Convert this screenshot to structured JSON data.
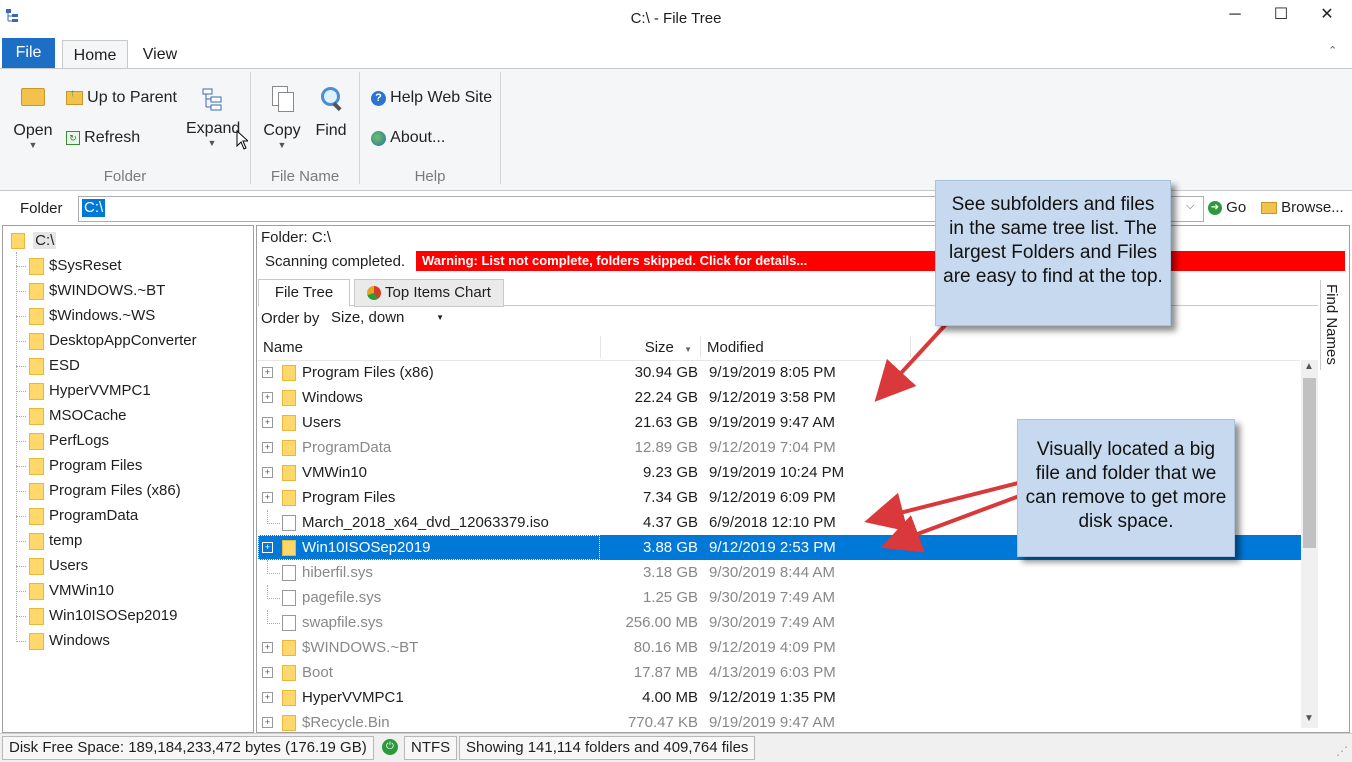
{
  "window": {
    "title": "C:\\ - File Tree",
    "minimize": "─",
    "maximize": "☐",
    "close": "✕"
  },
  "ribbon": {
    "tabs": {
      "file": "File",
      "home": "Home",
      "view": "View"
    },
    "folder_group": {
      "open": "Open",
      "up_to_parent": "Up to Parent",
      "refresh": "Refresh",
      "expand": "Expand",
      "label": "Folder"
    },
    "filename_group": {
      "copy": "Copy",
      "find": "Find",
      "label": "File Name"
    },
    "help_group": {
      "help_web_site": "Help Web Site",
      "about": "About...",
      "label": "Help"
    }
  },
  "folder_bar": {
    "label": "Folder",
    "value": "C:\\",
    "go": "Go",
    "browse": "Browse..."
  },
  "tree": {
    "root": "C:\\",
    "items": [
      "$SysReset",
      "$WINDOWS.~BT",
      "$Windows.~WS",
      "DesktopAppConverter",
      "ESD",
      "HyperVVMPC1",
      "MSOCache",
      "PerfLogs",
      "Program Files",
      "Program Files (x86)",
      "ProgramData",
      "temp",
      "Users",
      "VMWin10",
      "Win10ISOSep2019",
      "Windows"
    ]
  },
  "main": {
    "folder_path": "Folder: C:\\",
    "scan_status": "Scanning completed.",
    "warning": "Warning: List not complete, folders skipped. Click for details...",
    "tabs": {
      "file_tree": "File Tree",
      "top_items_chart": "Top Items Chart"
    },
    "order_by_label": "Order by",
    "order_by_value": "Size, down",
    "side_tab": "Find Names",
    "columns": {
      "name": "Name",
      "size": "Size",
      "modified": "Modified"
    },
    "rows": [
      {
        "name": "Program Files (x86)",
        "size": "30.94 GB",
        "modified": "9/19/2019 8:05 PM"
      },
      {
        "name": "Windows",
        "size": "22.24 GB",
        "modified": "9/12/2019 3:58 PM"
      },
      {
        "name": "Users",
        "size": "21.63 GB",
        "modified": "9/19/2019 9:47 AM"
      },
      {
        "name": "ProgramData",
        "size": "12.89 GB",
        "modified": "9/12/2019 7:04 PM"
      },
      {
        "name": "VMWin10",
        "size": "9.23 GB",
        "modified": "9/19/2019 10:24 PM"
      },
      {
        "name": "Program Files",
        "size": "7.34 GB",
        "modified": "9/12/2019 6:09 PM"
      },
      {
        "name": "March_2018_x64_dvd_12063379.iso",
        "size": "4.37 GB",
        "modified": "6/9/2018 12:10 PM"
      },
      {
        "name": "Win10ISOSep2019",
        "size": "3.88 GB",
        "modified": "9/12/2019 2:53 PM"
      },
      {
        "name": "hiberfil.sys",
        "size": "3.18 GB",
        "modified": "9/30/2019 8:44 AM"
      },
      {
        "name": "pagefile.sys",
        "size": "1.25 GB",
        "modified": "9/30/2019 7:49 AM"
      },
      {
        "name": "swapfile.sys",
        "size": "256.00 MB",
        "modified": "9/30/2019 7:49 AM"
      },
      {
        "name": "$WINDOWS.~BT",
        "size": "80.16 MB",
        "modified": "9/12/2019 4:09 PM"
      },
      {
        "name": "Boot",
        "size": "17.87 MB",
        "modified": "4/13/2019 6:03 PM"
      },
      {
        "name": "HyperVVMPC1",
        "size": "4.00 MB",
        "modified": "9/12/2019 1:35 PM"
      },
      {
        "name": "$Recycle.Bin",
        "size": "770.47 KB",
        "modified": "9/19/2019 9:47 AM"
      }
    ]
  },
  "callouts": {
    "top": "See subfolders and files in the same tree list. The largest Folders and Files are easy to find at the top.",
    "bottom": "Visually located a big file and folder that we can remove to get more disk space."
  },
  "status": {
    "disk_free": "Disk Free Space: 189,184,233,472 bytes (176.19 GB)",
    "fs": "NTFS",
    "showing": "Showing 141,114 folders and 409,764 files"
  }
}
